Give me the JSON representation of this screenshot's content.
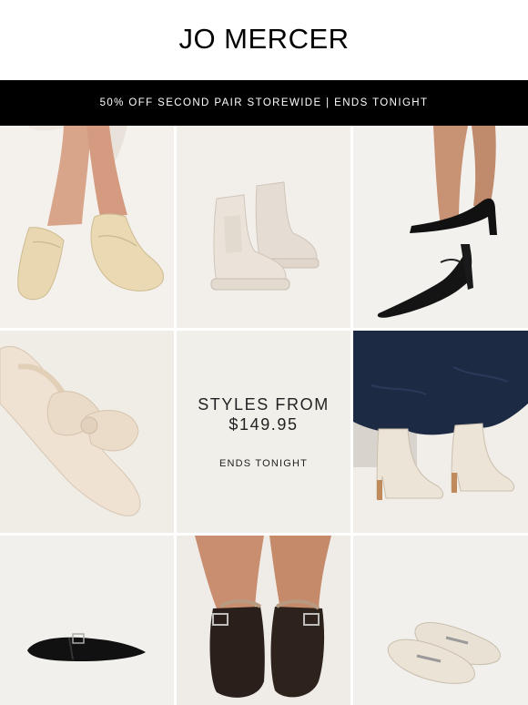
{
  "header": {
    "logo_text": "JO MERCER"
  },
  "banner": {
    "text": "50% OFF SECOND PAIR STOREWIDE | ENDS TONIGHT"
  },
  "promo": {
    "headline_line1": "STYLES FROM",
    "headline_line2": "$149.95",
    "subtext": "ENDS TONIGHT"
  },
  "products": [
    {
      "icon": "loafer-on-feet-image",
      "color": "#e8d7b0"
    },
    {
      "icon": "chelsea-boots-image",
      "color": "#e9e1d9"
    },
    {
      "icon": "slingback-heel-image",
      "color": "#111111"
    },
    {
      "icon": "bow-mule-image",
      "color": "#efe3d6"
    },
    {
      "icon": "white-ankle-boots-image",
      "color": "#ece4d6"
    },
    {
      "icon": "black-mary-jane-flat-image",
      "color": "#111111"
    },
    {
      "icon": "suede-clog-image",
      "color": "#2a1f1a"
    },
    {
      "icon": "cream-loafers-image",
      "color": "#eae3d8"
    }
  ]
}
